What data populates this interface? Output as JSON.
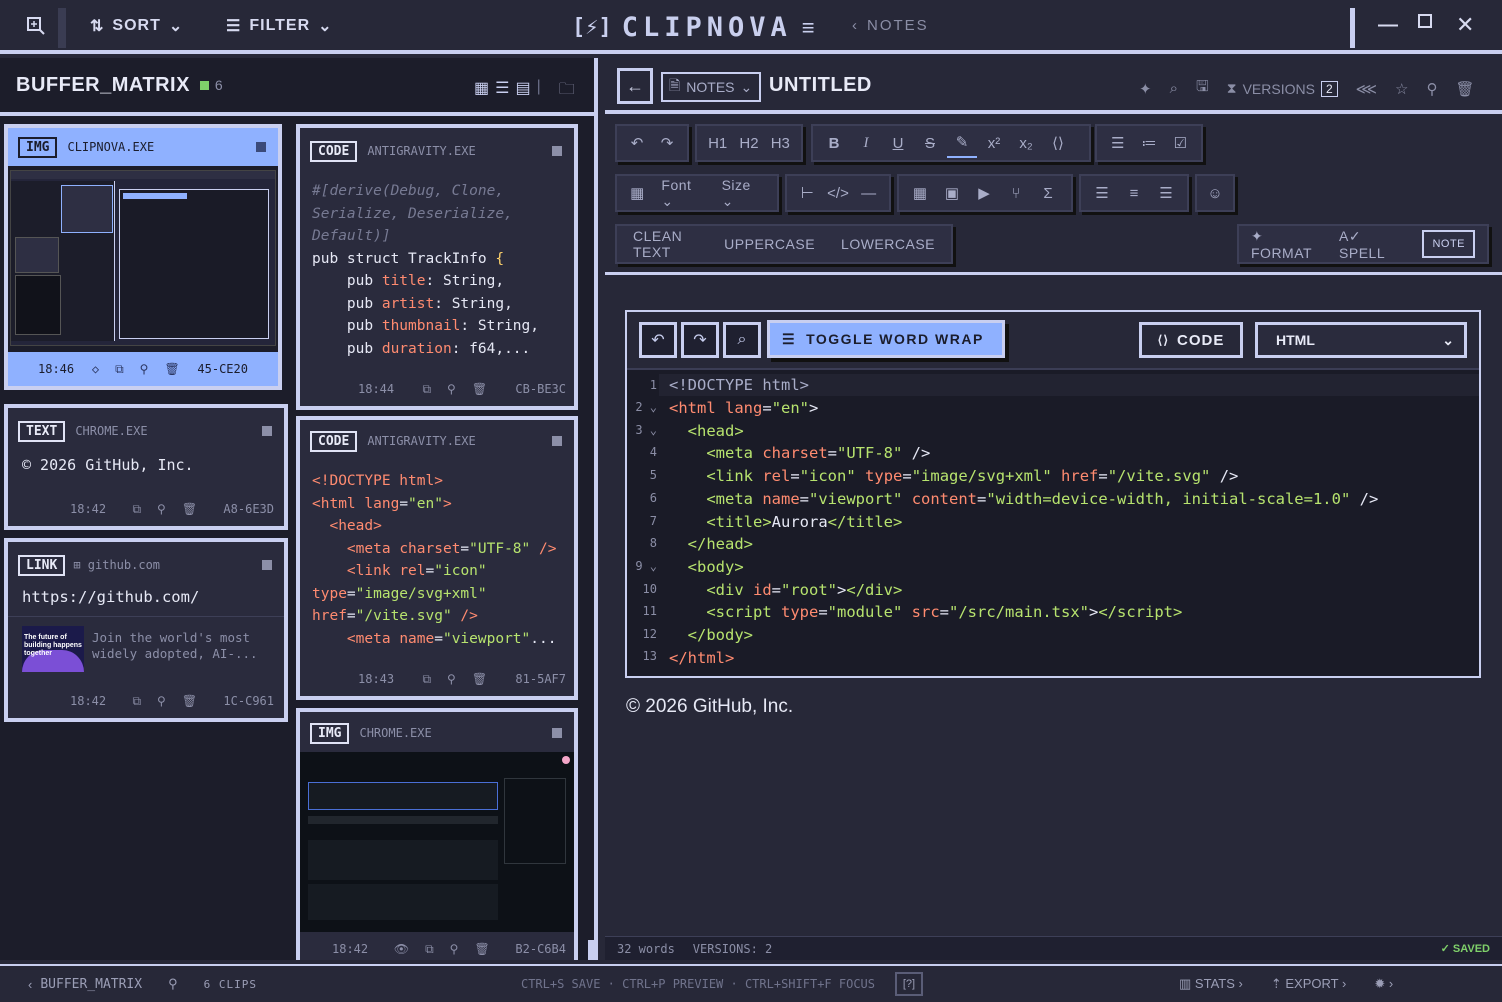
{
  "topbar": {
    "sort": "SORT",
    "filter": "FILTER",
    "app_title": "CLIPNOVA",
    "notes": "NOTES"
  },
  "left": {
    "title": "BUFFER_MATRIX",
    "count": "6"
  },
  "cards": [
    {
      "tag": "IMG",
      "source": "CLIPNOVA.EXE",
      "time": "18:46",
      "id": "45-CE20"
    },
    {
      "tag": "TEXT",
      "source": "CHROME.EXE",
      "content": "© 2026 GitHub, Inc.",
      "time": "18:42",
      "id": "A8-6E3D"
    },
    {
      "tag": "LINK",
      "source": "github.com",
      "url": "https://github.com/",
      "desc1": "Join the world's most",
      "desc2": "widely adopted, AI-...",
      "thumb_text": "The future of building happens together",
      "time": "18:42",
      "id": "1C-C961"
    },
    {
      "tag": "CODE",
      "source": "ANTIGRAVITY.EXE",
      "time": "18:44",
      "id": "CB-BE3C"
    },
    {
      "tag": "CODE",
      "source": "ANTIGRAVITY.EXE",
      "time": "18:43",
      "id": "81-5AF7"
    },
    {
      "tag": "IMG",
      "source": "CHROME.EXE",
      "time": "18:42",
      "id": "B2-C6B4"
    }
  ],
  "note": {
    "type": "NOTES",
    "title": "UNTITLED",
    "versions_label": "VERSIONS",
    "versions_count": "2"
  },
  "toolbar": {
    "font": "Font",
    "size": "Size",
    "clean": "CLEAN TEXT",
    "upper": "UPPERCASE",
    "lower": "LOWERCASE",
    "format": "FORMAT",
    "spell": "SPELL",
    "note": "NOTE"
  },
  "editor": {
    "wrap": "TOGGLE WORD WRAP",
    "code": "CODE",
    "lang": "HTML"
  },
  "content_text": "© 2026 GitHub, Inc.",
  "status": {
    "words": "32 words",
    "versions": "VERSIONS: 2",
    "saved": "SAVED"
  },
  "bottom": {
    "buffer": "BUFFER_MATRIX",
    "clips": "6 CLIPS",
    "shortcuts": "CTRL+S SAVE · CTRL+P PREVIEW · CTRL+SHIFT+F FOCUS",
    "stats": "STATS",
    "export": "EXPORT"
  }
}
